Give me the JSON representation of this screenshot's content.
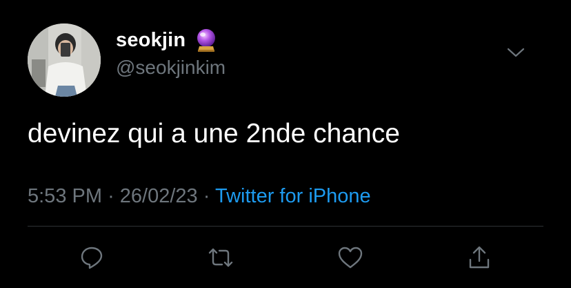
{
  "tweet": {
    "author": {
      "display_name": "seokjin",
      "handle": "@seokjinkim",
      "name_emoji": "crystal-ball-emoji"
    },
    "text": "devinez qui a une 2nde chance",
    "time": "5:53 PM",
    "separator": "·",
    "date": "26/02/23",
    "source": "Twitter for iPhone"
  },
  "actions": [
    "reply-icon",
    "retweet-icon",
    "like-icon",
    "share-icon"
  ],
  "colors": {
    "background": "#000000",
    "primary_text": "#ffffff",
    "secondary_text": "#6e767d",
    "accent": "#1d9bf0",
    "divider": "#2f3336"
  }
}
